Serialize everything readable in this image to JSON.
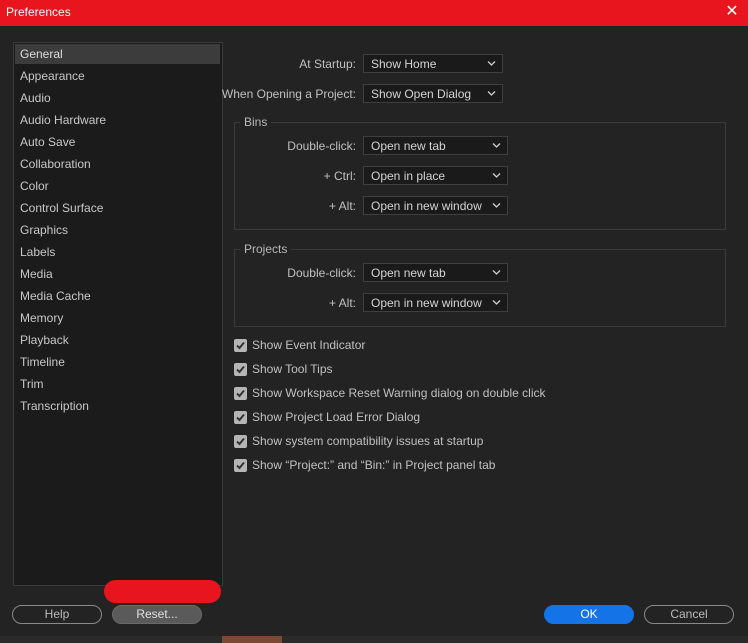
{
  "window": {
    "title": "Preferences",
    "close_glyph": "✕",
    "title_bar_color": "#e8141e"
  },
  "sidebar": {
    "items": [
      {
        "label": "General",
        "selected": true
      },
      {
        "label": "Appearance"
      },
      {
        "label": "Audio"
      },
      {
        "label": "Audio Hardware"
      },
      {
        "label": "Auto Save"
      },
      {
        "label": "Collaboration"
      },
      {
        "label": "Color"
      },
      {
        "label": "Control Surface"
      },
      {
        "label": "Graphics"
      },
      {
        "label": "Labels"
      },
      {
        "label": "Media"
      },
      {
        "label": "Media Cache"
      },
      {
        "label": "Memory"
      },
      {
        "label": "Playback"
      },
      {
        "label": "Timeline"
      },
      {
        "label": "Trim"
      },
      {
        "label": "Transcription"
      }
    ]
  },
  "general": {
    "at_startup": {
      "label": "At Startup:",
      "value": "Show Home"
    },
    "opening_project": {
      "label": "When Opening a Project:",
      "value": "Show Open Dialog"
    },
    "bins": {
      "title": "Bins",
      "double_click": {
        "label": "Double-click:",
        "value": "Open new tab"
      },
      "ctrl": {
        "label": "+ Ctrl:",
        "value": "Open in place"
      },
      "alt": {
        "label": "+ Alt:",
        "value": "Open in new window"
      }
    },
    "projects": {
      "title": "Projects",
      "double_click": {
        "label": "Double-click:",
        "value": "Open new tab"
      },
      "alt": {
        "label": "+ Alt:",
        "value": "Open in new window"
      }
    },
    "checkboxes": [
      {
        "label": "Show Event Indicator",
        "checked": true
      },
      {
        "label": "Show Tool Tips",
        "checked": true
      },
      {
        "label": "Show Workspace Reset Warning dialog on double click",
        "checked": true
      },
      {
        "label": "Show Project Load Error Dialog",
        "checked": true
      },
      {
        "label": "Show system compatibility issues at startup",
        "checked": true
      },
      {
        "label": "Show “Project:” and “Bin:” in Project panel tab",
        "checked": true
      }
    ]
  },
  "footer": {
    "help_label": "Help",
    "reset_label": "Reset...",
    "ok_label": "OK",
    "cancel_label": "Cancel"
  },
  "colors": {
    "accent_blue": "#1473e6",
    "redaction_red": "#e8141e"
  },
  "icons": {
    "close": "close-icon",
    "chevron": "chevron-down-icon",
    "check": "checkmark-icon"
  }
}
